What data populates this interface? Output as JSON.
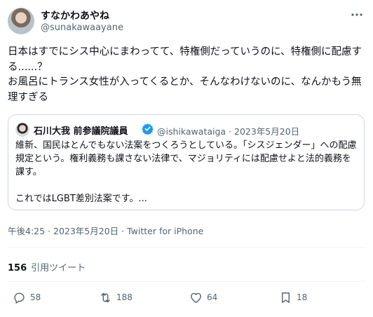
{
  "author": {
    "name": "すなかわあやね",
    "handle": "@sunakawaayane"
  },
  "tweet": {
    "lines": [
      "日本はすでにシス中心にまわってて、特権側だっていうのに、特権側に配慮する......？",
      "お風呂にトランス女性が入ってくるとか、そんなわけないのに、なんかもう無理すぎる"
    ]
  },
  "quoted": {
    "name": "石川大我 前参議院議員",
    "meta": "@ishikawataiga · 2023年5月20日",
    "text_line1": "維新、国民はとんでもない法案をつくろうとしている。「シスジェンダー」への配慮規定という。権利義務も課さない法律で、マジョリティには配慮せよと法的義務を課す。",
    "text_line2": "これではLGBT差別法案です。..."
  },
  "timestamp": "午後4:25 · 2023年5月20日 · Twitter for iPhone",
  "stats": {
    "quote_count": "156",
    "quote_label": "引用ツイート"
  },
  "actions": {
    "reply_count": "58",
    "retweet_count": "188",
    "like_count": "64",
    "bookmark_count": "18"
  },
  "colors": {
    "secondary_text": "#536471",
    "verified_blue": "#1d9bf0",
    "border": "#cfd9de"
  },
  "icons": [
    "more-icon",
    "verified-badge-icon",
    "reply-icon",
    "retweet-icon",
    "like-icon",
    "bookmark-icon"
  ]
}
